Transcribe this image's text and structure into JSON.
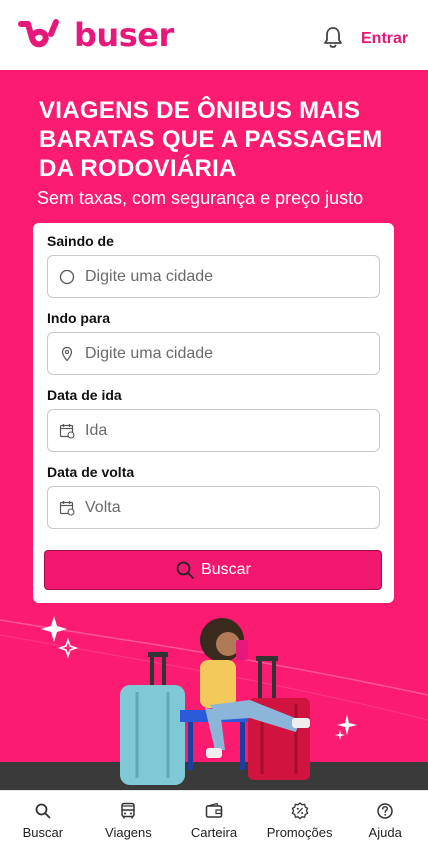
{
  "header": {
    "brand": "buser",
    "signin_label": "Entrar",
    "brand_color": "#e6197a"
  },
  "hero": {
    "title": "VIAGENS DE ÔNIBUS MAIS BARATAS QUE A PASSAGEM DA RODOVIÁRIA",
    "subtitle": "Sem taxas, com segurança e preço justo",
    "background_color": "#fb1c72"
  },
  "search_form": {
    "origin": {
      "label": "Saindo de",
      "placeholder": "Digite uma cidade",
      "icon": "circle-icon"
    },
    "destination": {
      "label": "Indo para",
      "placeholder": "Digite uma cidade",
      "icon": "location-pin-icon"
    },
    "departure": {
      "label": "Data de ida",
      "placeholder": "Ida",
      "icon": "calendar-icon"
    },
    "return": {
      "label": "Data de volta",
      "placeholder": "Volta",
      "icon": "calendar-icon"
    },
    "submit_label": "Buscar"
  },
  "bottom_nav": {
    "items": [
      {
        "label": "Buscar",
        "icon": "search-icon"
      },
      {
        "label": "Viagens",
        "icon": "bus-icon"
      },
      {
        "label": "Carteira",
        "icon": "wallet-icon"
      },
      {
        "label": "Promoções",
        "icon": "discount-badge-icon"
      },
      {
        "label": "Ajuda",
        "icon": "help-icon"
      }
    ]
  }
}
